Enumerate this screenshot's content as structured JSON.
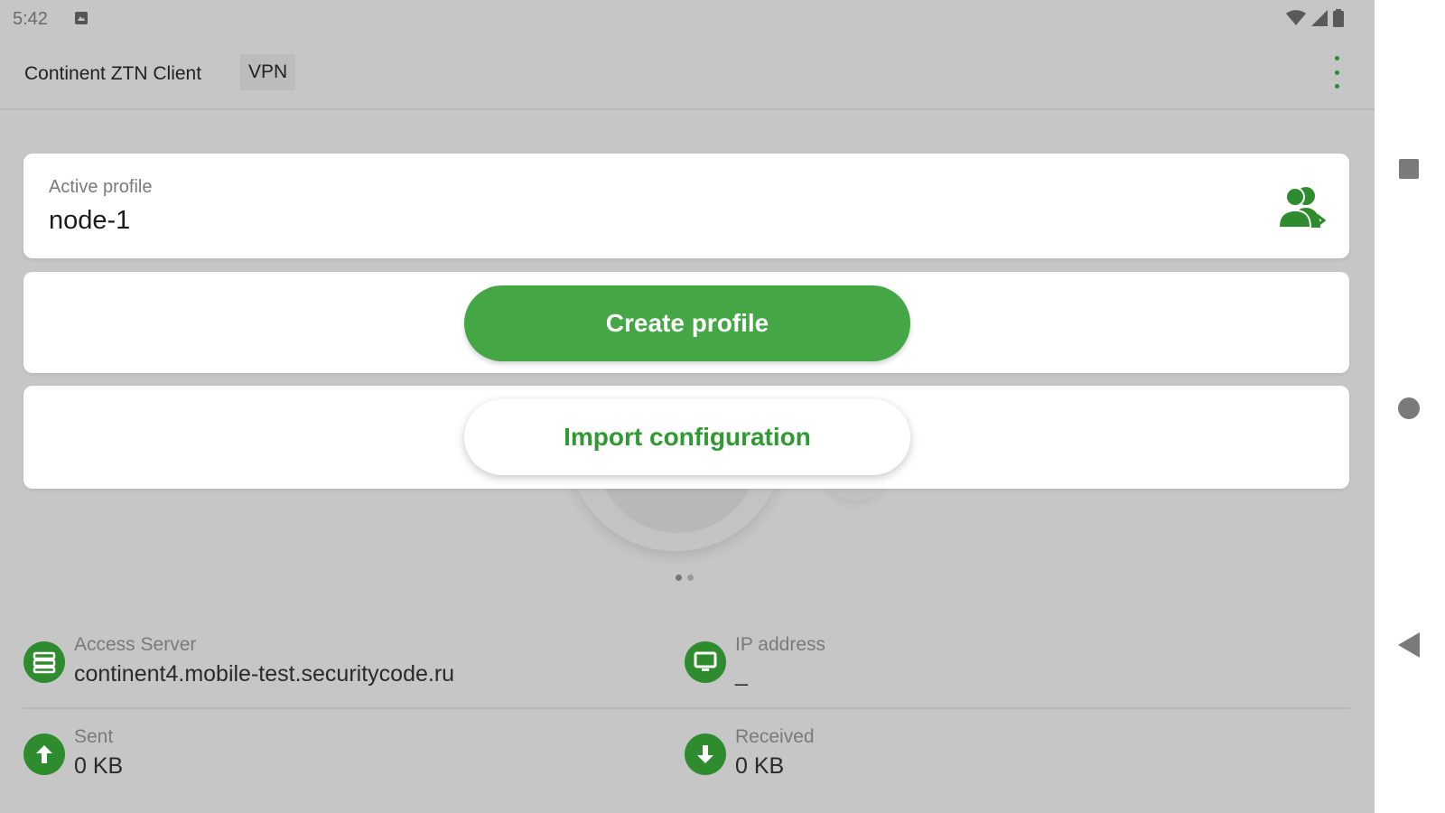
{
  "status_bar": {
    "time": "5:42",
    "notification_icon": "notification-icon",
    "icons": [
      "wifi-icon",
      "cell-signal-icon",
      "battery-icon"
    ]
  },
  "toolbar": {
    "title": "Continent ZTN Client",
    "chip": "VPN",
    "overflow_icon": "more-vert-icon",
    "accent_color": "#2e8b2e"
  },
  "profile_card": {
    "label": "Active profile",
    "value": "node-1",
    "switch_icon": "switch-profile-icon"
  },
  "actions": {
    "create_profile": "Create profile",
    "import_configuration": "Import configuration",
    "primary_color": "#44a645"
  },
  "pager": {
    "pages": 2,
    "active": 1
  },
  "info": {
    "access_server": {
      "label": "Access Server",
      "value": "continent4.mobile-test.securitycode.ru",
      "icon": "server-icon"
    },
    "ip_address": {
      "label": "IP address",
      "value": "_",
      "icon": "monitor-icon"
    },
    "sent": {
      "label": "Sent",
      "value": "0 KB",
      "icon": "upload-arrow-icon"
    },
    "received": {
      "label": "Received",
      "value": "0 KB",
      "icon": "download-arrow-icon"
    }
  },
  "nav_bar": {
    "items": [
      "recents-icon",
      "home-icon",
      "back-icon"
    ]
  }
}
